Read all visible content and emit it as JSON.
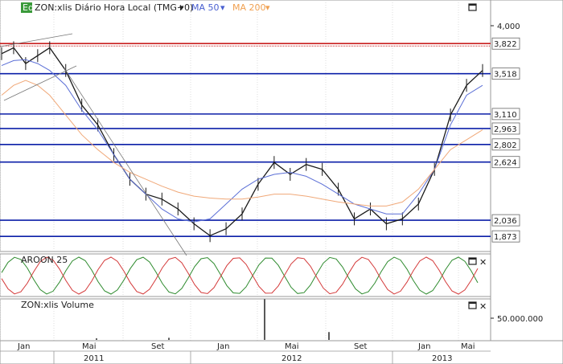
{
  "header": {
    "badge": "Eq",
    "symbol_label": "ZON:xlis Diário Hora Local (TMG+0)",
    "ma50_label": "MA 50",
    "ma200_label": "MA 200"
  },
  "colors": {
    "price": "#1a1a1a",
    "ma50": "#5b6fd6",
    "ma200": "#f0a878",
    "hline": "#0b1fa8",
    "resistance": "#c81e1e",
    "aroon_up": "#2e8b2e",
    "aroon_down": "#d43a3a",
    "grid": "#c8c8c8"
  },
  "chart_data": [
    {
      "type": "line",
      "name": "price-panel",
      "ylim": [
        1.72,
        4.1
      ],
      "y_ticks": [
        "4,000"
      ],
      "price_levels": [
        "3,822",
        "3,518",
        "3,110",
        "2,963",
        "2,802",
        "2,624",
        "2,036",
        "1,873"
      ],
      "resistance_level": 3.822,
      "series": [
        {
          "name": "ZON:xlis",
          "x": [
            0,
            3,
            6,
            9,
            12,
            16,
            20,
            24,
            28,
            32,
            36,
            40,
            44,
            48,
            52,
            56,
            60,
            64,
            68,
            72,
            76,
            80,
            84,
            88,
            92,
            96,
            100,
            104,
            108,
            112,
            116,
            120
          ],
          "y": [
            3.72,
            3.78,
            3.62,
            3.7,
            3.78,
            3.55,
            3.2,
            3.0,
            2.7,
            2.45,
            2.3,
            2.25,
            2.15,
            2.0,
            1.88,
            1.95,
            2.1,
            2.4,
            2.62,
            2.5,
            2.6,
            2.55,
            2.35,
            2.05,
            2.15,
            2.0,
            2.05,
            2.2,
            2.55,
            3.1,
            3.4,
            3.55
          ]
        },
        {
          "name": "MA 50",
          "y": [
            3.6,
            3.65,
            3.66,
            3.62,
            3.55,
            3.4,
            3.15,
            2.95,
            2.7,
            2.45,
            2.3,
            2.15,
            2.05,
            2.02,
            2.05,
            2.2,
            2.35,
            2.45,
            2.5,
            2.52,
            2.48,
            2.4,
            2.3,
            2.2,
            2.15,
            2.1,
            2.1,
            2.3,
            2.55,
            3.0,
            3.3,
            3.4
          ]
        },
        {
          "name": "MA 200",
          "y": [
            3.3,
            3.4,
            3.45,
            3.4,
            3.3,
            3.1,
            2.9,
            2.75,
            2.62,
            2.52,
            2.45,
            2.38,
            2.32,
            2.28,
            2.26,
            2.25,
            2.25,
            2.27,
            2.3,
            2.3,
            2.28,
            2.25,
            2.22,
            2.2,
            2.18,
            2.18,
            2.22,
            2.35,
            2.55,
            2.75,
            2.85,
            2.95
          ]
        }
      ]
    },
    {
      "type": "line",
      "name": "aroon-panel",
      "title": "AROON 25",
      "ylim": [
        0,
        100
      ]
    },
    {
      "type": "bar",
      "name": "volume-panel",
      "title": "ZON:xlis Volume",
      "y_ticks": [
        "50.000.000"
      ],
      "spikes": [
        {
          "x": 329,
          "value": 78000000
        },
        {
          "x": 409,
          "value": 15000000
        },
        {
          "x": 210,
          "value": 4000000
        },
        {
          "x": 120,
          "value": 3000000
        }
      ]
    }
  ],
  "x_axis": {
    "months": [
      "Jan",
      "Mai",
      "Set",
      "Jan",
      "Mai",
      "Set",
      "Jan",
      "Mai"
    ],
    "years": [
      "2011",
      "2012",
      "2013"
    ]
  }
}
